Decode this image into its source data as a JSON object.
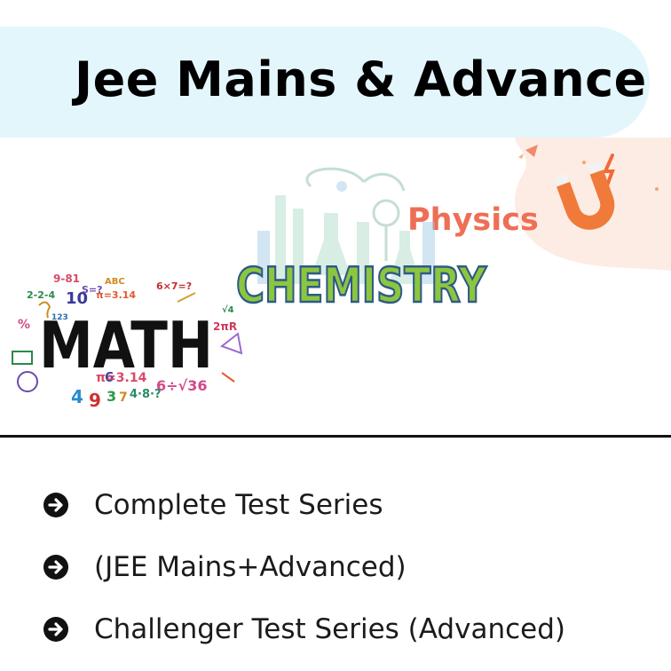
{
  "banner": {
    "title": "Jee Mains & Advance"
  },
  "subjects": {
    "physics": "Physics",
    "chemistry": "CHEMISTRY",
    "math": "MATH"
  },
  "math_doodles": [
    "9-81",
    "10",
    "2-2-4",
    "S=?",
    "ABC",
    "6×7=?",
    "123",
    "π=3.14",
    "2πR",
    "6÷√36",
    "4·8·?",
    "4",
    "9",
    "3",
    "7",
    "6",
    "%",
    "√4"
  ],
  "features": [
    {
      "text": "Complete Test Series",
      "icon": "arrow-circle-right-icon"
    },
    {
      "text": "(JEE Mains+Advanced)",
      "icon": "arrow-circle-right-icon"
    },
    {
      "text": "Challenger Test Series (Advanced)",
      "icon": "arrow-circle-right-icon"
    }
  ],
  "colors": {
    "banner_bg": "#e3f6fc",
    "physics_text": "#ee6e56",
    "chemistry_fill": "#8cc63f",
    "chemistry_stroke": "#2e5a88",
    "divider": "#111111"
  }
}
